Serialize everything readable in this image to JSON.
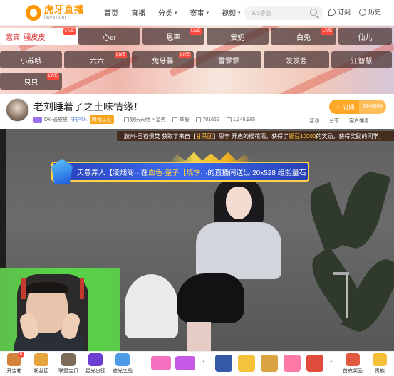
{
  "brand": {
    "name_cn": "虎牙直播",
    "name_en": "huya.com",
    "color": "#ff9600"
  },
  "nav": {
    "items": [
      {
        "label": "首页",
        "dropdown": false
      },
      {
        "label": "直播",
        "dropdown": false
      },
      {
        "label": "分类",
        "dropdown": true
      },
      {
        "label": "赛事",
        "dropdown": true
      },
      {
        "label": "视频",
        "dropdown": true
      }
    ],
    "search_placeholder": "3v3手游",
    "subscribe_label": "订阅",
    "history_label": "历史"
  },
  "banner": {
    "first_chip": "嘉宾: 骚皮皮",
    "live_tag": "LIVE",
    "chips": [
      {
        "label": "心er",
        "live": false
      },
      {
        "label": "恩率",
        "live": true
      },
      {
        "label": "安妮",
        "live": false
      },
      {
        "label": "白兔",
        "live": true
      },
      {
        "label": "仙儿",
        "live": false
      },
      {
        "label": "小苏哦",
        "live": false
      },
      {
        "label": "六六",
        "live": true
      },
      {
        "label": "兔牙馨",
        "live": true
      },
      {
        "label": "雪霏霏",
        "live": false
      },
      {
        "label": "发发酱",
        "live": false
      },
      {
        "label": "江智慧",
        "live": false
      },
      {
        "label": "只只",
        "live": true
      }
    ]
  },
  "room": {
    "title": "老刘睡着了之土味情缘！",
    "host": "DK-骚皮皮",
    "guard": "守护TA",
    "cert": "腾讯认证",
    "category_path": "娱乐天地 > 星秀",
    "report_label": "举报",
    "activity": "活动",
    "viewers": "701662",
    "fans": "1,346,985",
    "subscribe_label": "订阅",
    "subscribe_count": "2440884",
    "share_label": "分享",
    "client_label": "客户端看"
  },
  "video": {
    "marquee": {
      "prefix": "胶州-玉石俱焚 获取了来自【",
      "group": "甘蔗团",
      "mid": "】思宁 开启的樱花雨，获得了",
      "reward": "银豆10000",
      "suffix": "的奖励，获得奖励的同学，"
    },
    "gift_banner": {
      "sender": "天意弄人【凌烟阁",
      "in_label": "在",
      "room": "血色·童子【烧饼",
      "suffix": "的直播间送出 20x528 组能量石"
    }
  },
  "bottom_bar": {
    "left": [
      {
        "label": "开宝箱",
        "badge": "6",
        "color": "#d4833a"
      },
      {
        "label": "粉丝团",
        "badge": "",
        "color": "#e8a43c"
      },
      {
        "label": "联盟宝贝",
        "badge": "",
        "color": "#7c6b58"
      },
      {
        "label": "星光出征",
        "badge": "",
        "color": "#6c3fd0"
      },
      {
        "label": "遮光之战",
        "badge": "",
        "color": "#4d9be8"
      }
    ],
    "promos": [
      {
        "color": "#f472c0"
      },
      {
        "color": "#c659e6"
      }
    ],
    "gifts": [
      {
        "color": "#3558a8"
      },
      {
        "color": "#f5c23c"
      },
      {
        "color": "#d9a441"
      },
      {
        "color": "#ff7aa6"
      },
      {
        "color": "#e04b3b"
      }
    ],
    "right": [
      {
        "label": "首充奖励",
        "color": "#e05a40"
      },
      {
        "label": "贵族",
        "color": "#f4c03a"
      }
    ]
  }
}
